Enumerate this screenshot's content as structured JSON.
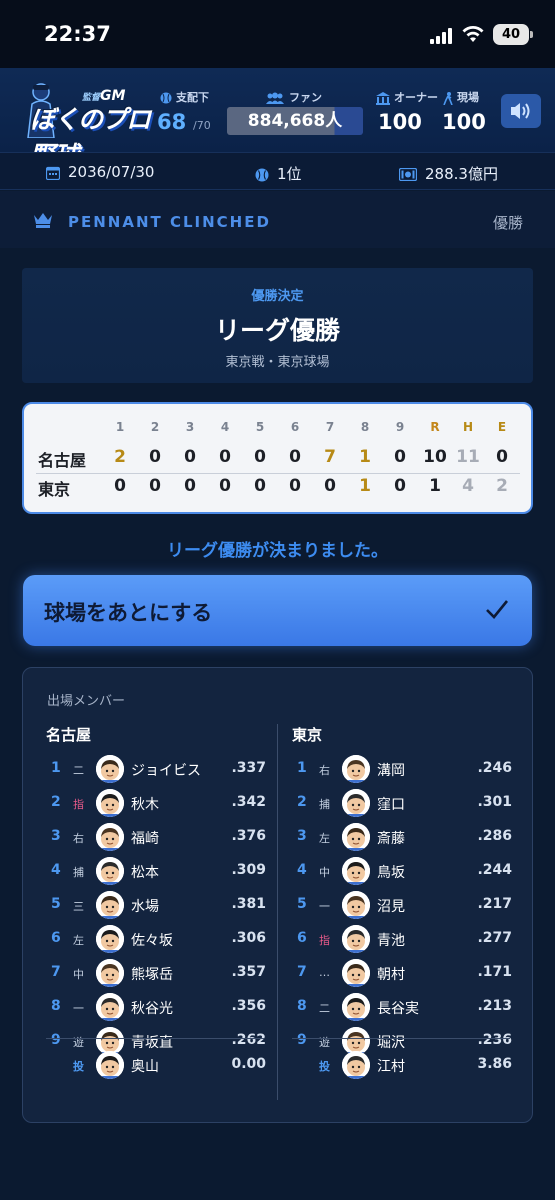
{
  "status": {
    "time": "22:37",
    "battery": "40"
  },
  "header": {
    "logo_text": "ぼくのプロ野球",
    "logo_sub": "GM",
    "shihai": {
      "label": "支配下",
      "value": "68",
      "max": "/70"
    },
    "fan": {
      "label": "ファン",
      "value": "884,668人",
      "progress": 0.79
    },
    "owner": {
      "label": "オーナー",
      "value": "100"
    },
    "field": {
      "label": "現場",
      "value": "100"
    }
  },
  "info": {
    "date": "2036/07/30",
    "rank": "1位",
    "money": "288.3億円"
  },
  "pennant": {
    "title": "PENNANT CLINCHED",
    "right": "優勝"
  },
  "result": {
    "sub": "優勝決定",
    "title": "リーグ優勝",
    "venue": "東京戦・東京球場"
  },
  "scoreboard": {
    "headers": [
      "1",
      "2",
      "3",
      "4",
      "5",
      "6",
      "7",
      "8",
      "9",
      "R",
      "H",
      "E"
    ],
    "rows": [
      {
        "team": "名古屋",
        "scores": [
          "2",
          "0",
          "0",
          "0",
          "0",
          "0",
          "7",
          "1",
          "0",
          "10",
          "11",
          "0"
        ]
      },
      {
        "team": "東京",
        "scores": [
          "0",
          "0",
          "0",
          "0",
          "0",
          "0",
          "0",
          "1",
          "0",
          "1",
          "4",
          "2"
        ]
      }
    ]
  },
  "decided_text": "リーグ優勝が決まりました。",
  "leave_button": "球場をあとにする",
  "roster": {
    "title": "出場メンバー",
    "left": {
      "team": "名古屋",
      "players": [
        {
          "order": "1",
          "pos": "二",
          "name": "ジョイビス",
          "avg": ".337"
        },
        {
          "order": "2",
          "pos": "指",
          "name": "秋木",
          "avg": ".342"
        },
        {
          "order": "3",
          "pos": "右",
          "name": "福崎",
          "avg": ".376"
        },
        {
          "order": "4",
          "pos": "捕",
          "name": "松本",
          "avg": ".309"
        },
        {
          "order": "5",
          "pos": "三",
          "name": "水場",
          "avg": ".381"
        },
        {
          "order": "6",
          "pos": "左",
          "name": "佐々坂",
          "avg": ".306"
        },
        {
          "order": "7",
          "pos": "中",
          "name": "熊塚岳",
          "avg": ".357"
        },
        {
          "order": "8",
          "pos": "一",
          "name": "秋谷光",
          "avg": ".356"
        },
        {
          "order": "9",
          "pos": "遊",
          "name": "青坂直",
          "avg": ".262"
        }
      ],
      "pitcher": {
        "pos": "投",
        "name": "奥山",
        "era": "0.00"
      }
    },
    "right": {
      "team": "東京",
      "players": [
        {
          "order": "1",
          "pos": "右",
          "name": "溝岡",
          "avg": ".246"
        },
        {
          "order": "2",
          "pos": "捕",
          "name": "窪口",
          "avg": ".301"
        },
        {
          "order": "3",
          "pos": "左",
          "name": "斎藤",
          "avg": ".286"
        },
        {
          "order": "4",
          "pos": "中",
          "name": "鳥坂",
          "avg": ".244"
        },
        {
          "order": "5",
          "pos": "一",
          "name": "沼見",
          "avg": ".217"
        },
        {
          "order": "6",
          "pos": "指",
          "name": "青池",
          "avg": ".277"
        },
        {
          "order": "7",
          "pos": "…",
          "name": "朝村",
          "avg": ".171"
        },
        {
          "order": "8",
          "pos": "二",
          "name": "長谷実",
          "avg": ".213"
        },
        {
          "order": "9",
          "pos": "遊",
          "name": "堀沢",
          "avg": ".236"
        }
      ],
      "pitcher": {
        "pos": "投",
        "name": "江村",
        "era": "3.86"
      }
    }
  },
  "colors": {
    "accent": "#4d98f0",
    "background": "#0b1a30",
    "button": "#4a8af0",
    "gold": "#b78a16"
  }
}
